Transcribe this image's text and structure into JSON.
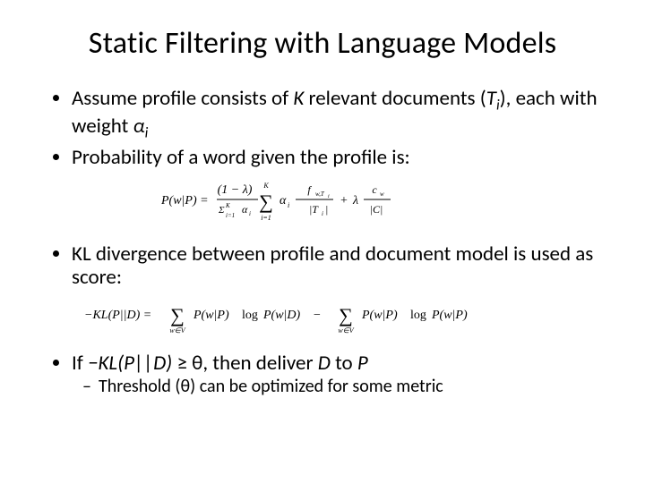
{
  "title": "Static Filtering with Language Models",
  "bullets": {
    "b1_pre": "Assume profile consists of ",
    "b1_K": "K",
    "b1_mid1": " relevant documents (",
    "b1_Ti": "T",
    "b1_Ti_sub": "i",
    "b1_mid2": "), each with weight ",
    "b1_alpha": "α",
    "b1_alpha_sub": "i",
    "b2": "Probability of a word given the profile is:",
    "b3": "KL divergence between profile and document model is used as score:",
    "b4_pre": "If ",
    "b4_kl": "−KL",
    "b4_args": "(P||D)",
    "b4_post": " ≥ θ, then deliver ",
    "b4_D": "D",
    "b4_to": " to ",
    "b4_P": "P",
    "sub1": "Threshold (θ) can be optimized for some metric"
  },
  "formulas": {
    "f1_latex": "P(w|P) = (1-λ)/(Σ_{i=1}^{K} α_i) · Σ_{i=1}^{K} α_i · f_{w,T_i}/|T_i| + λ · c_w/|C|",
    "f2_latex": "-KL(P||D) = Σ_{w∈V} P(w|P) log P(w|D) − Σ_{w∈V} P(w|P) log P(w|P)"
  }
}
